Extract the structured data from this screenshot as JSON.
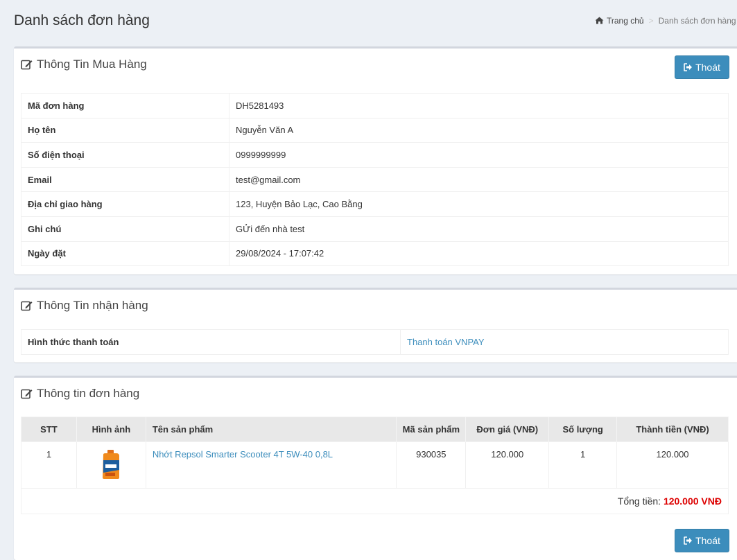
{
  "page": {
    "title": "Danh sách đơn hàng",
    "breadcrumb": {
      "home": "Trang chủ",
      "separator": ">",
      "current": "Danh sách đơn hàng"
    }
  },
  "buyer": {
    "title": "Thông Tin Mua Hàng",
    "exit_label": "Thoát",
    "rows": [
      {
        "label": "Mã đơn hàng",
        "value": "DH5281493"
      },
      {
        "label": "Họ tên",
        "value": "Nguyễn Văn A"
      },
      {
        "label": "Số điện thoại",
        "value": "0999999999"
      },
      {
        "label": "Email",
        "value": "test@gmail.com"
      },
      {
        "label": "Địa chỉ giao hàng",
        "value": "123, Huyện Bảo Lạc, Cao Bằng"
      },
      {
        "label": "Ghi chú",
        "value": "GỬi đến nhà test"
      },
      {
        "label": "Ngày đặt",
        "value": "29/08/2024 - 17:07:42"
      }
    ]
  },
  "receiver": {
    "title": "Thông Tin nhận hàng",
    "payment_label": "Hình thức thanh toán",
    "payment_value": "Thanh toán VNPAY"
  },
  "order": {
    "title": "Thông tin đơn hàng",
    "columns": [
      "STT",
      "Hình ảnh",
      "Tên sản phẩm",
      "Mã sản phẩm",
      "Đơn giá (VNĐ)",
      "Số lượng",
      "Thành tiền (VNĐ)"
    ],
    "items": [
      {
        "stt": "1",
        "name": "Nhớt Repsol Smarter Scooter 4T 5W-40 0,8L",
        "code": "930035",
        "price": "120.000",
        "qty": "1",
        "total": "120.000"
      }
    ],
    "total_label": "Tổng tiền:",
    "total_value": "120.000 VNĐ",
    "exit_label": "Thoát"
  },
  "colors": {
    "primary": "#3c8dbc",
    "total": "#dd0000"
  }
}
